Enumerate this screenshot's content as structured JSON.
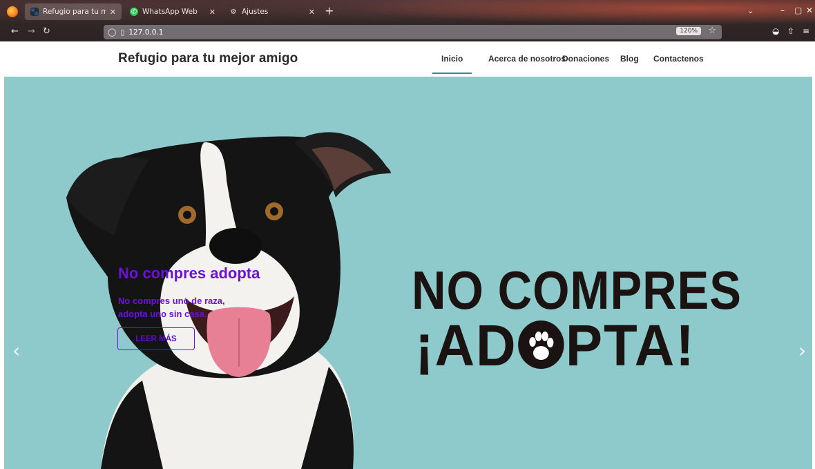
{
  "browser": {
    "tabs": [
      {
        "title": "Refugio para tu mejor an",
        "active": true
      },
      {
        "title": "WhatsApp Web",
        "active": false
      },
      {
        "title": "Ajustes",
        "active": false
      }
    ],
    "url": "127.0.0.1",
    "zoom": "120%"
  },
  "site": {
    "brand": "Refugio para tu mejor amigo",
    "menu": [
      "Inicio",
      "Acerca de nosotros",
      "Donaciones",
      "Blog",
      "Contactenos"
    ],
    "active_menu": "Inicio"
  },
  "hero": {
    "caption_title": "No compres adopta",
    "caption_text": "No compres uno de raza, adopta uno sin casa.",
    "cta_label": "LEER MÁS",
    "slogan_line1": "NO COMPRES",
    "slogan_line2_a": "¡AD",
    "slogan_line2_b": "PTA!",
    "background_color": "#8ecacb",
    "accent_color": "#6b12d8"
  }
}
